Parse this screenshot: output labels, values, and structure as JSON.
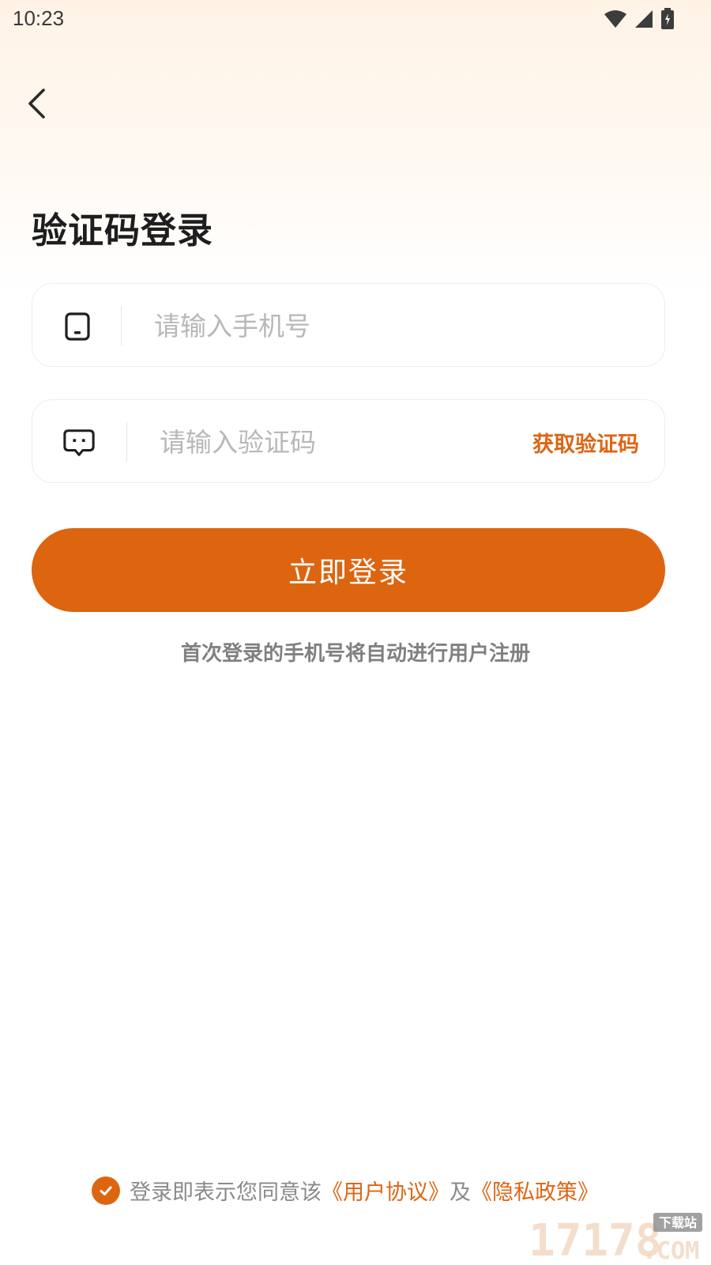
{
  "status_bar": {
    "time": "10:23"
  },
  "header": {
    "title": "验证码登录"
  },
  "form": {
    "phone_placeholder": "请输入手机号",
    "code_placeholder": "请输入验证码",
    "get_code_label": "获取验证码",
    "login_label": "立即登录",
    "register_note": "首次登录的手机号将自动进行用户注册"
  },
  "agreement": {
    "checked": true,
    "prefix": "登录即表示您同意该",
    "user_agreement": "《用户协议》",
    "conjunction": "及",
    "privacy_policy": "《隐私政策》"
  },
  "watermark": {
    "number": "17178",
    "domain": ".COM",
    "site": "下载站"
  },
  "colors": {
    "accent": "#DD6510",
    "link": "#DD6514",
    "placeholder": "#B8B8B8",
    "note": "#808080"
  },
  "icons": {
    "back": "chevron-left-icon",
    "phone": "phone-icon",
    "code": "message-icon",
    "check": "check-icon",
    "wifi": "wifi-icon",
    "signal": "signal-icon",
    "battery": "battery-icon"
  }
}
